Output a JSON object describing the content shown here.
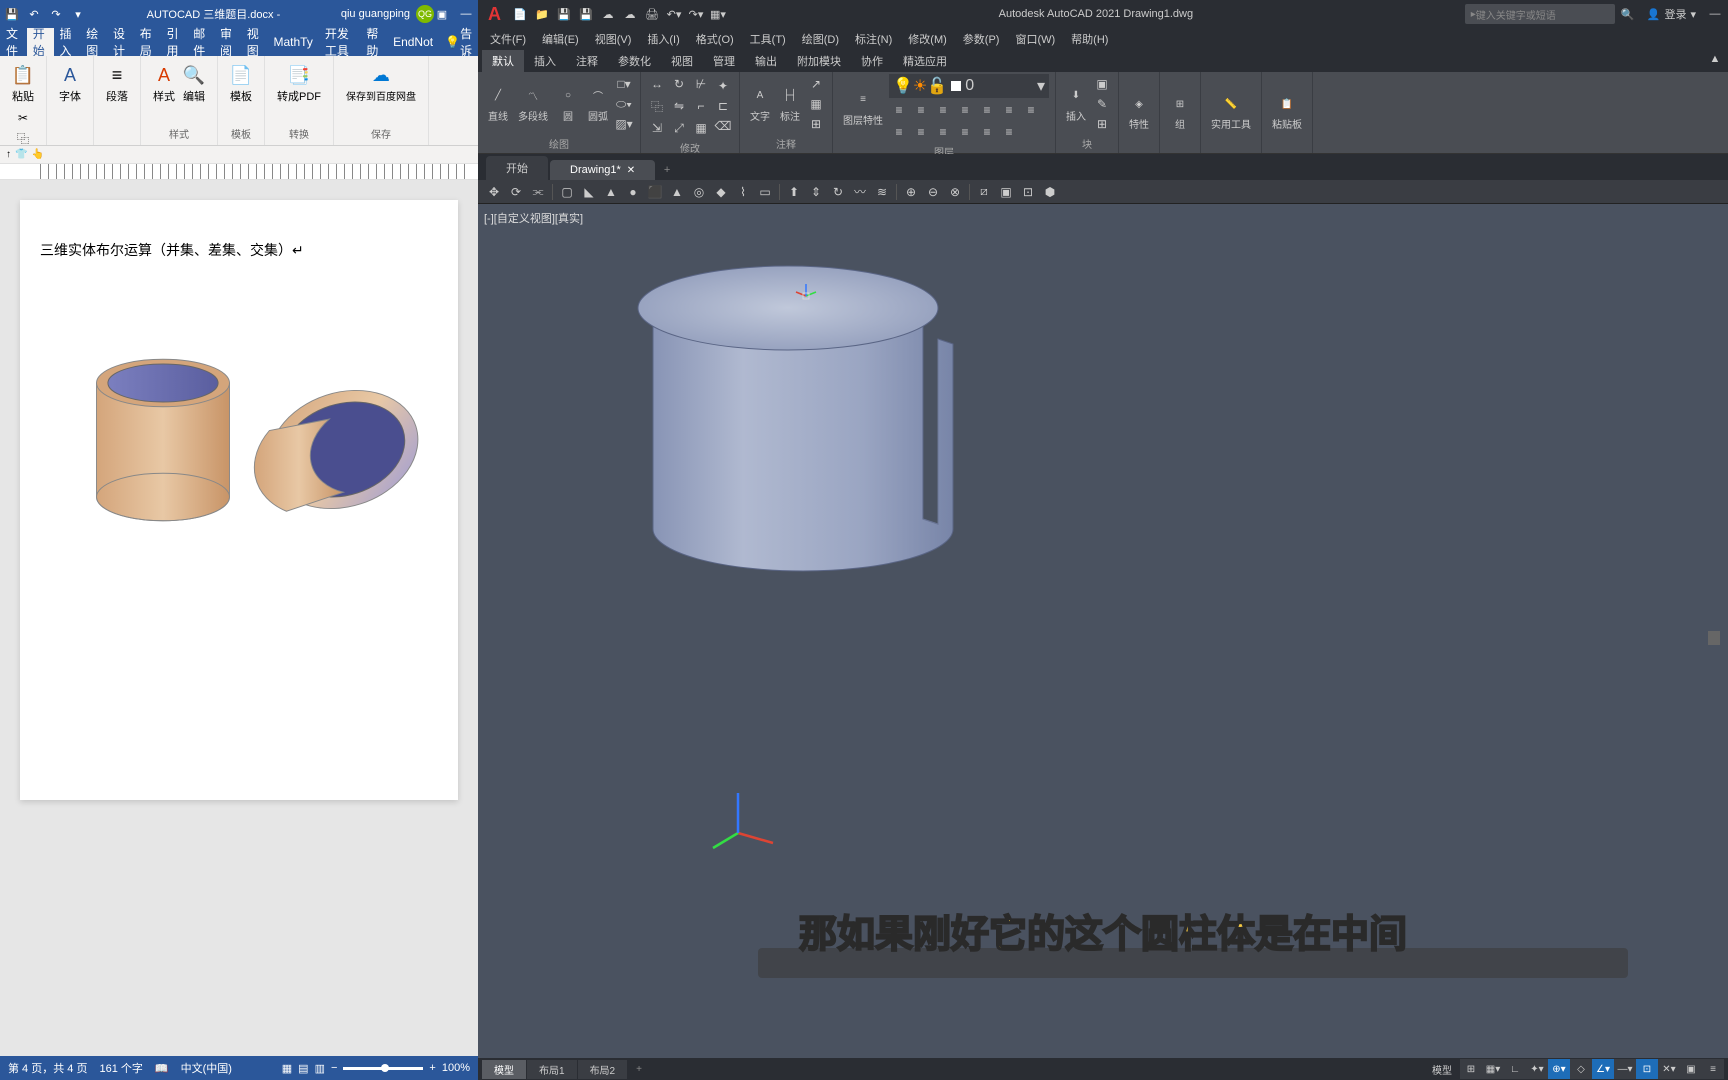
{
  "word": {
    "title": "AUTOCAD 三维题目.docx -",
    "username": "qiu guangping",
    "avatar": "QG",
    "tabs": {
      "file": "文件",
      "home": "开始",
      "insert": "插入",
      "draw": "绘图",
      "design": "设计",
      "layout": "布局",
      "refs": "引用",
      "mail": "邮件",
      "review": "审阅",
      "view": "视图",
      "mathtype": "MathTy",
      "devtools": "开发工具",
      "help": "帮助",
      "endnote": "EndNot",
      "tellme": "告诉"
    },
    "ribbon": {
      "paste": "粘贴",
      "font": "字体",
      "paragraph": "段落",
      "styles": "样式",
      "styles_label": "样式",
      "edit": "编辑",
      "template": "模板",
      "template_label": "模板",
      "topdf": "转成PDF",
      "convert_label": "转换",
      "baidu": "保存到百度网盘",
      "save_label": "保存"
    },
    "doc": {
      "heading": "三维实体布尔运算（并集、差集、交集）↵"
    },
    "status": {
      "page": "第 4 页，共 4 页",
      "words": "161 个字",
      "lang": "中文(中国)",
      "zoom": "100%"
    }
  },
  "acad": {
    "title": "Autodesk AutoCAD 2021   Drawing1.dwg",
    "search_placeholder": "键入关键字或短语",
    "login": "登录",
    "menus": {
      "file": "文件(F)",
      "edit": "编辑(E)",
      "view": "视图(V)",
      "insert": "插入(I)",
      "format": "格式(O)",
      "tools": "工具(T)",
      "draw": "绘图(D)",
      "dimension": "标注(N)",
      "modify": "修改(M)",
      "param": "参数(P)",
      "window": "窗口(W)",
      "help": "帮助(H)"
    },
    "rtabs": {
      "default": "默认",
      "insert": "插入",
      "annotate": "注释",
      "parametric": "参数化",
      "view": "视图",
      "manage": "管理",
      "output": "输出",
      "addins": "附加模块",
      "collab": "协作",
      "express": "精选应用"
    },
    "ribbon": {
      "line": "直线",
      "polyline": "多段线",
      "circle": "圆",
      "arc": "圆弧",
      "draw_label": "绘图",
      "modify_label": "修改",
      "text": "文字",
      "dim": "标注",
      "annotate_label": "注释",
      "layer_props": "图层特性",
      "layers_label": "图层",
      "layer_current": "0",
      "insert": "插入",
      "block_label": "块",
      "props": "特性",
      "group": "组",
      "utilities": "实用工具",
      "clipboard": "粘贴板"
    },
    "filetabs": {
      "start": "开始",
      "drawing1": "Drawing1*"
    },
    "viewport": {
      "label": "[-][自定义视图][真实]"
    },
    "layouts": {
      "model": "模型",
      "layout1": "布局1",
      "layout2": "布局2"
    },
    "status_model": "模型"
  },
  "subtitle": "那如果刚好它的这个圆柱体是在中间"
}
